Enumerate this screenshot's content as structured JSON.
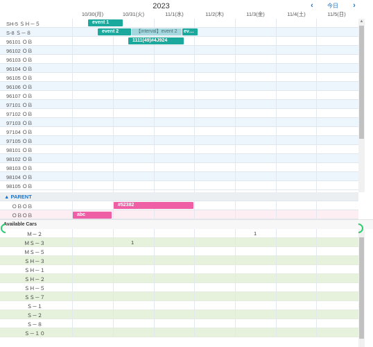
{
  "header": {
    "year": "2023",
    "prev_label": "‹",
    "today_label": "今日",
    "next_label": "›"
  },
  "dates": [
    "10/30(月)",
    "10/31(火)",
    "11/1(水)",
    "11/2(木)",
    "11/3(金)",
    "11/4(土)",
    "11/5(日)"
  ],
  "resources": [
    {
      "label": "SH-5 ＳＨ－５"
    },
    {
      "label": "S-8 Ｓ－８"
    },
    {
      "label": "96101 ＯＢ"
    },
    {
      "label": "96102 ＯＢ"
    },
    {
      "label": "96103 ＯＢ"
    },
    {
      "label": "96104 ＯＢ"
    },
    {
      "label": "96105 ＯＢ"
    },
    {
      "label": "96106 ＯＢ"
    },
    {
      "label": "96107 ＯＢ"
    },
    {
      "label": "97101 ＯＢ"
    },
    {
      "label": "97102 ＯＢ"
    },
    {
      "label": "97103 ＯＢ"
    },
    {
      "label": "97104 ＯＢ"
    },
    {
      "label": "97105 ＯＢ"
    },
    {
      "label": "98101 ＯＢ"
    },
    {
      "label": "98102 ＯＢ"
    },
    {
      "label": "98103 ＯＢ"
    },
    {
      "label": "98104 ＯＢ"
    },
    {
      "label": "98105 ＯＢ"
    }
  ],
  "events": [
    {
      "title": "event 1",
      "type": "teal"
    },
    {
      "title": "event 2",
      "type": "teal"
    },
    {
      "title": "【interval】event 2",
      "type": "light"
    },
    {
      "title": "ev…",
      "type": "teal"
    },
    {
      "title": "1111(49)#4J924",
      "type": "teal"
    },
    {
      "title": "#52382",
      "type": "pink"
    },
    {
      "title": "abc",
      "type": "pink"
    }
  ],
  "parent_group": {
    "label": "▲ PARENT",
    "children": [
      {
        "label": "ＯＢＯＢ"
      },
      {
        "label": "ＯＢＯＢ"
      }
    ]
  },
  "available_cars": {
    "title": "Available Cars",
    "cars": [
      {
        "label": "Ｍ－２",
        "count": "1"
      },
      {
        "label": "ＭＳ－３",
        "count": "1"
      },
      {
        "label": "ＭＳ－５",
        "count": ""
      },
      {
        "label": "ＳＨ－３",
        "count": ""
      },
      {
        "label": "ＳＨ－１",
        "count": ""
      },
      {
        "label": "ＳＨ－２",
        "count": ""
      },
      {
        "label": "ＳＨ－５",
        "count": ""
      },
      {
        "label": "ＳＳ－７",
        "count": ""
      },
      {
        "label": "Ｓ－１",
        "count": ""
      },
      {
        "label": "Ｓ－２",
        "count": ""
      },
      {
        "label": "Ｓ－８",
        "count": ""
      },
      {
        "label": "Ｓ－１０",
        "count": ""
      }
    ]
  },
  "colors": {
    "accent": "#1a73c9",
    "event_teal": "#1aa99c",
    "event_light": "#a5d7df",
    "event_pink": "#ee5fa6",
    "car_row_green": "#e6f2dc"
  }
}
